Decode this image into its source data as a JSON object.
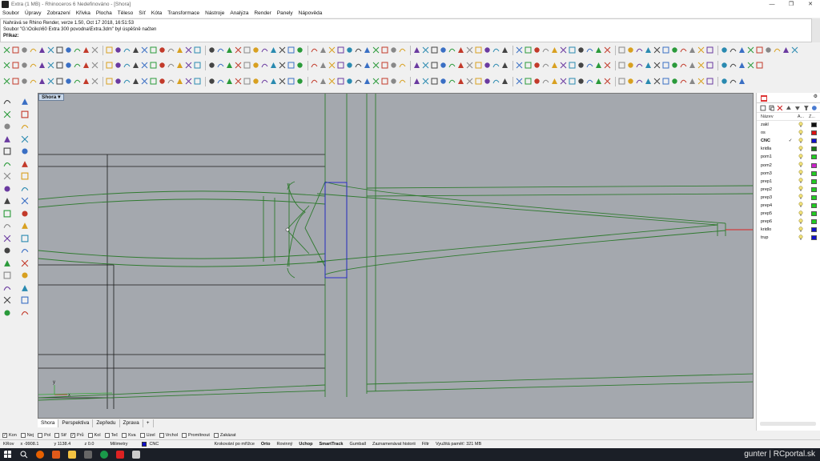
{
  "window": {
    "title": "Extra (1 MB) - Rhinoceros 6 Nedefinováno - [Shora]",
    "controls": [
      "—",
      "❐",
      "✕"
    ]
  },
  "menu": [
    "Soubor",
    "Úpravy",
    "Zobrazení",
    "Křivka",
    "Plocha",
    "Těleso",
    "Síť",
    "Kóta",
    "Transformace",
    "Nástroje",
    "Analýza",
    "Render",
    "Panely",
    "Nápověda"
  ],
  "command": {
    "history": [
      "Nahrává se Rhino Render, verze 1.50, Oct 17 2018, 16:51:53",
      "Soubor \"G:\\Ociko\\60 Extra 300 povodna\\Extra.3dm\" byl úspěšně načten"
    ],
    "prompt": "Příkaz:"
  },
  "viewport": {
    "active_name": "Shora",
    "tabs": [
      "Shora",
      "Perspektiva",
      "Zepředu",
      "Zprava"
    ],
    "add_tab": "+",
    "axis_labels": [
      "y",
      "x"
    ],
    "colors": {
      "background": "#a4a8ae",
      "curve": "#2f7a2f",
      "black_line": "#1a1a1a",
      "selection": "#2222cc",
      "axis_x": "#d22",
      "axis_y": "#3a3"
    }
  },
  "layers": {
    "headers": [
      "Název",
      "A...",
      "Z..."
    ],
    "rows": [
      {
        "name": "zakl",
        "current": "",
        "color": "#111111"
      },
      {
        "name": "os",
        "current": "",
        "color": "#dd1111"
      },
      {
        "name": "CNC",
        "current": "✓",
        "color": "#1111cc"
      },
      {
        "name": "kridla",
        "current": "",
        "color": "#1a7a1a"
      },
      {
        "name": "pom1",
        "current": "",
        "color": "#22cc22"
      },
      {
        "name": "pom2",
        "current": "",
        "color": "#cc22cc"
      },
      {
        "name": "pom3",
        "current": "",
        "color": "#22cc22"
      },
      {
        "name": "prep1",
        "current": "",
        "color": "#22cc22"
      },
      {
        "name": "prep2",
        "current": "",
        "color": "#22cc22"
      },
      {
        "name": "prep3",
        "current": "",
        "color": "#22cc22"
      },
      {
        "name": "prep4",
        "current": "",
        "color": "#22cc22"
      },
      {
        "name": "prep5",
        "current": "",
        "color": "#22cc22"
      },
      {
        "name": "prep6",
        "current": "",
        "color": "#22cc22"
      },
      {
        "name": "kridlo",
        "current": "",
        "color": "#1111cc"
      },
      {
        "name": "trup",
        "current": "",
        "color": "#1111cc"
      }
    ]
  },
  "osnap": [
    {
      "label": "Kon",
      "checked": true
    },
    {
      "label": "Nej",
      "checked": false
    },
    {
      "label": "Pol",
      "checked": false
    },
    {
      "label": "Stř",
      "checked": false
    },
    {
      "label": "Prů",
      "checked": true
    },
    {
      "label": "Kol",
      "checked": false
    },
    {
      "label": "Teč",
      "checked": false
    },
    {
      "label": "Kva",
      "checked": false
    },
    {
      "label": "Uzel",
      "checked": false
    },
    {
      "label": "Vrchol",
      "checked": false
    },
    {
      "label": "Promítnout",
      "checked": false
    },
    {
      "label": "Zakázat",
      "checked": false
    }
  ],
  "status": {
    "plane": "KRov",
    "x": "x -9908.1",
    "y": "y 1138.4",
    "z": "z 0.0",
    "units": "Milimetry",
    "layer": "CNC",
    "layer_color": "#1111cc",
    "toggles": [
      "Krokování po mřížce",
      "Orto",
      "Rovinný",
      "Uchop",
      "SmartTrack",
      "Gumball",
      "Zaznamenávat historii",
      "Filtr"
    ],
    "memory": "Využitá paměť: 321 MB"
  },
  "watermark": "gunter | RCportal.sk"
}
